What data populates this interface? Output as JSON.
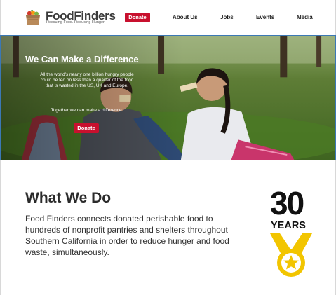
{
  "header": {
    "logo_name": "FoodFinders",
    "logo_tagline": "Rescuing Food. Reducing Hunger.",
    "donate_label": "Donate",
    "nav": [
      "About Us",
      "Jobs",
      "Events",
      "Media"
    ]
  },
  "hero": {
    "title": "We Can Make a Difference",
    "text": "All the world’s nearly one billion hungry people could be fed on less than a quarter of the food that is wasted in the US, UK and Europe.",
    "subtext": "Together we can make a difference.",
    "donate_label": "Donate"
  },
  "main": {
    "title": "What We Do",
    "body": "Food Finders connects donated perishable food to hundreds of nonprofit pantries and shelters throughout Southern California in order to reduce hunger and food waste, simultaneously.",
    "badge_number": "30",
    "badge_label": "YEARS"
  },
  "colors": {
    "brand_red": "#c8102e",
    "medal_gold": "#f2c500",
    "hero_border": "#3b78b5"
  },
  "icons": [
    "logo-crate-icon",
    "medal-star-icon"
  ]
}
